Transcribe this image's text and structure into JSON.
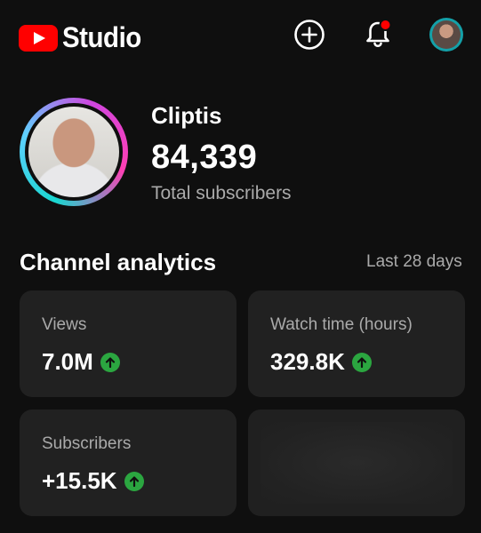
{
  "header": {
    "logo_text": "Studio",
    "icons": {
      "create": "add-circle-icon",
      "notifications": "bell-icon"
    },
    "notification_badge_color": "#ff0000"
  },
  "channel": {
    "name": "Cliptis",
    "subscriber_count": "84,339",
    "subscriber_label": "Total subscribers"
  },
  "analytics": {
    "title": "Channel analytics",
    "period": "Last 28 days",
    "trend_color": "#2ba640",
    "cards": [
      {
        "label": "Views",
        "value": "7.0M",
        "trend": "up"
      },
      {
        "label": "Watch time (hours)",
        "value": "329.8K",
        "trend": "up"
      },
      {
        "label": "Subscribers",
        "value": "+15.5K",
        "trend": "up"
      }
    ]
  }
}
